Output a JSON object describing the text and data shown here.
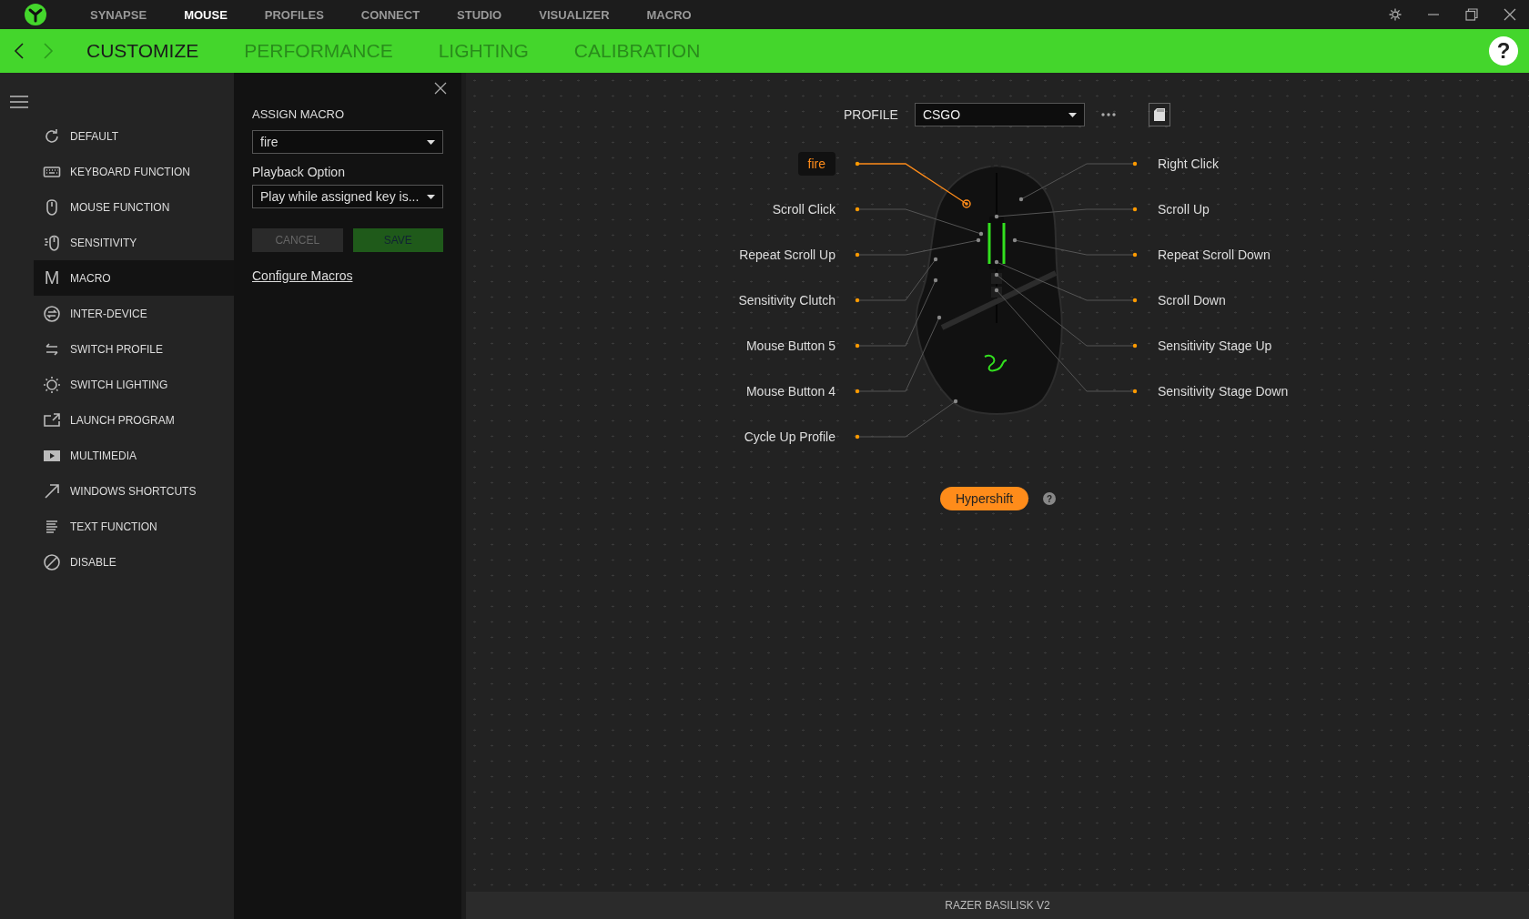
{
  "top_nav": {
    "tabs": [
      {
        "label": "SYNAPSE",
        "selected": false
      },
      {
        "label": "MOUSE",
        "selected": true
      },
      {
        "label": "PROFILES",
        "selected": false
      },
      {
        "label": "CONNECT",
        "selected": false
      },
      {
        "label": "STUDIO",
        "selected": false
      },
      {
        "label": "VISUALIZER",
        "selected": false
      },
      {
        "label": "MACRO",
        "selected": false
      }
    ]
  },
  "sub_nav": {
    "tabs": [
      {
        "label": "CUSTOMIZE",
        "selected": true
      },
      {
        "label": "PERFORMANCE",
        "selected": false
      },
      {
        "label": "LIGHTING",
        "selected": false
      },
      {
        "label": "CALIBRATION",
        "selected": false
      }
    ],
    "help": "?"
  },
  "sidebar": {
    "items": [
      {
        "label": "DEFAULT",
        "selected": false
      },
      {
        "label": "KEYBOARD FUNCTION",
        "selected": false
      },
      {
        "label": "MOUSE FUNCTION",
        "selected": false
      },
      {
        "label": "SENSITIVITY",
        "selected": false
      },
      {
        "label": "MACRO",
        "selected": true,
        "glyph": "M"
      },
      {
        "label": "INTER-DEVICE",
        "selected": false
      },
      {
        "label": "SWITCH PROFILE",
        "selected": false
      },
      {
        "label": "SWITCH LIGHTING",
        "selected": false
      },
      {
        "label": "LAUNCH PROGRAM",
        "selected": false
      },
      {
        "label": "MULTIMEDIA",
        "selected": false
      },
      {
        "label": "WINDOWS SHORTCUTS",
        "selected": false
      },
      {
        "label": "TEXT FUNCTION",
        "selected": false
      },
      {
        "label": "DISABLE",
        "selected": false
      }
    ]
  },
  "macro_panel": {
    "title": "ASSIGN MACRO",
    "macro": "fire",
    "playback_label": "Playback Option",
    "playback": "Play while assigned key is...",
    "cancel": "CANCEL",
    "save": "SAVE",
    "link": "Configure Macros"
  },
  "profile": {
    "label": "PROFILE",
    "value": "CSGO"
  },
  "buttons_left": [
    {
      "label": "fire",
      "selected": true
    },
    {
      "label": "Scroll Click",
      "selected": false
    },
    {
      "label": "Repeat Scroll Up",
      "selected": false
    },
    {
      "label": "Sensitivity Clutch",
      "selected": false
    },
    {
      "label": "Mouse Button 5",
      "selected": false
    },
    {
      "label": "Mouse Button 4",
      "selected": false
    },
    {
      "label": "Cycle Up Profile",
      "selected": false
    }
  ],
  "buttons_right": [
    {
      "label": "Right Click",
      "selected": false
    },
    {
      "label": "Scroll Up",
      "selected": false
    },
    {
      "label": "Repeat Scroll Down",
      "selected": false
    },
    {
      "label": "Scroll Down",
      "selected": false
    },
    {
      "label": "Sensitivity Stage Up",
      "selected": false
    },
    {
      "label": "Sensitivity Stage Down",
      "selected": false
    }
  ],
  "hypershift": {
    "label": "Hypershift",
    "help": "?"
  },
  "status_bar": "RAZER BASILISK V2"
}
